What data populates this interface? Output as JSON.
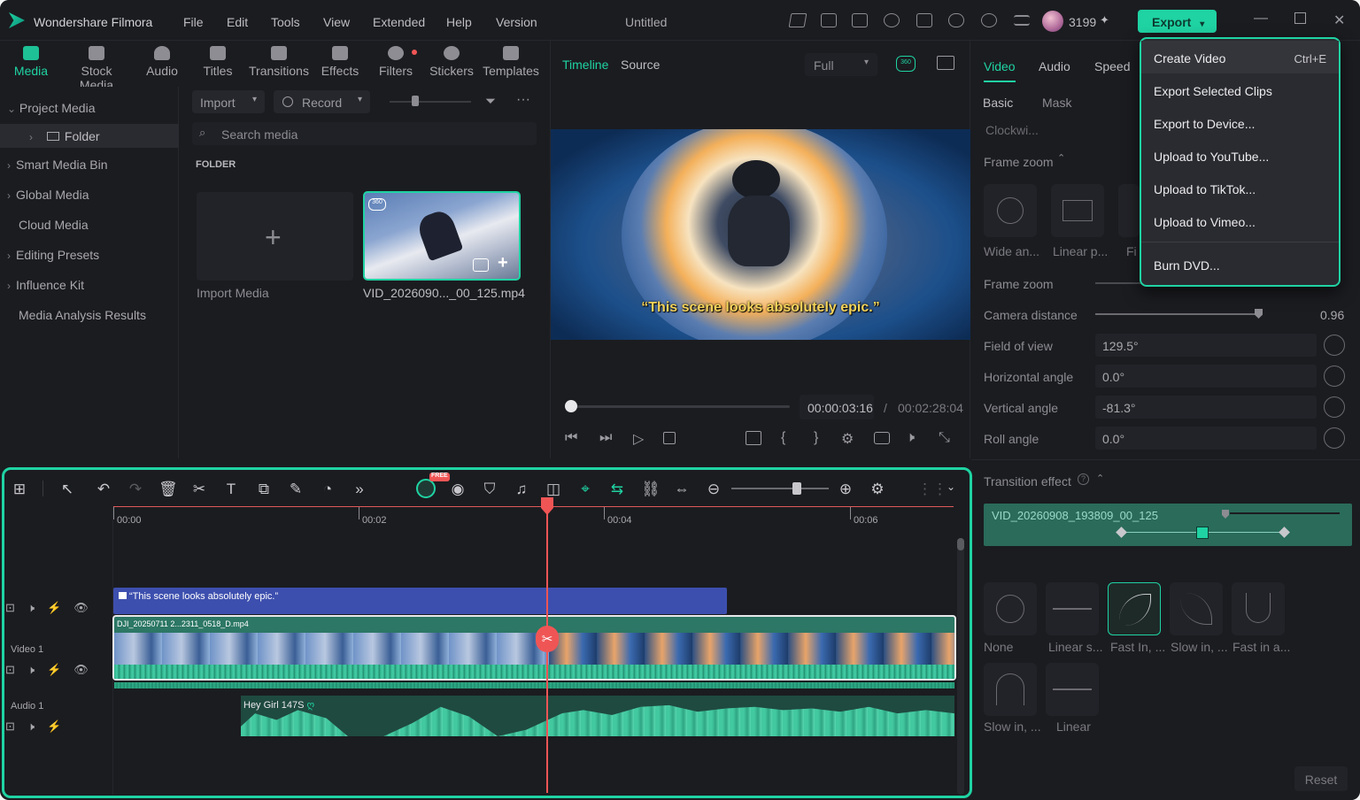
{
  "app": {
    "name": "Wondershare Filmora",
    "document_title": "Untitled",
    "credits": "3199",
    "export_label": "Export"
  },
  "menu": [
    "File",
    "Edit",
    "Tools",
    "View",
    "Extended",
    "Help",
    "Version"
  ],
  "media_tabs": [
    {
      "label": "Media",
      "active": true
    },
    {
      "label": "Stock Media"
    },
    {
      "label": "Audio"
    },
    {
      "label": "Titles"
    },
    {
      "label": "Transitions"
    },
    {
      "label": "Effects"
    },
    {
      "label": "Filters"
    },
    {
      "label": "Stickers"
    },
    {
      "label": "Templates"
    }
  ],
  "left_panel": {
    "items": [
      "Project Media",
      "Folder",
      "Smart Media Bin",
      "Global Media",
      "Cloud Media",
      "Editing Presets",
      "Influence Kit",
      "Media Analysis Results"
    ]
  },
  "media": {
    "import_label": "Import",
    "record_label": "Record",
    "search_placeholder": "Search media",
    "folder_heading": "FOLDER",
    "import_media_label": "Import Media",
    "clip_name": "VID_2026090..._00_125.mp4"
  },
  "preview": {
    "timeline_tab": "Timeline",
    "source_tab": "Source",
    "quality": "Full",
    "subtitle": "“This scene looks absolutely epic.”",
    "current_time": "00:00:03:16",
    "separator": "/",
    "total_time": "00:02:28:04",
    "progress_percent": 2
  },
  "right_panel": {
    "tabs": [
      "Video",
      "Audio",
      "Speed"
    ],
    "subtabs": [
      "Basic",
      "Mask"
    ],
    "clockwise": "Clockwi...",
    "frame_zoom_heading": "Frame zoom",
    "presets": [
      "Wide an...",
      "Linear p...",
      "Fi"
    ],
    "fields": [
      {
        "label": "Frame zoom",
        "value": ""
      },
      {
        "label": "Camera distance",
        "value": "0.96"
      },
      {
        "label": "Field of view",
        "value": "129.5°"
      },
      {
        "label": "Horizontal angle",
        "value": "0.0°"
      },
      {
        "label": "Vertical angle",
        "value": "-81.3°"
      },
      {
        "label": "Roll angle",
        "value": "0.0°"
      }
    ],
    "transition_heading": "Transition effect",
    "transition_clip": "VID_20260908_193809_00_125",
    "curves": [
      "None",
      "Linear s...",
      "Fast In, ...",
      "Slow in, ...",
      "Fast in a...",
      "Slow in, ...",
      "Linear"
    ],
    "reset_label": "Reset"
  },
  "export_menu": {
    "items": [
      {
        "label": "Create Video",
        "shortcut": "Ctrl+E"
      },
      {
        "label": "Export Selected Clips"
      },
      {
        "label": "Export to Device..."
      },
      {
        "label": "Upload to YouTube..."
      },
      {
        "label": "Upload to TikTok..."
      },
      {
        "label": "Upload to Vimeo..."
      },
      {
        "label": "Burn DVD..."
      }
    ]
  },
  "timeline": {
    "free_badge": "FREE",
    "ticks": [
      "00:00",
      "00:02",
      "00:04",
      "00:06"
    ],
    "tracks": [
      "Video 1",
      "Audio 1"
    ],
    "subtitle_clip": "“This scene looks absolutely epic.”",
    "video_clip": "DJI_20250711 2...2311_0518_D.mp4",
    "audio_clip": "Hey Girl 147S"
  },
  "colors": {
    "accent": "#1fd3a3",
    "playhead": "#f05555",
    "subtitle_track": "#3d4fae",
    "video_track": "#2c7765"
  }
}
